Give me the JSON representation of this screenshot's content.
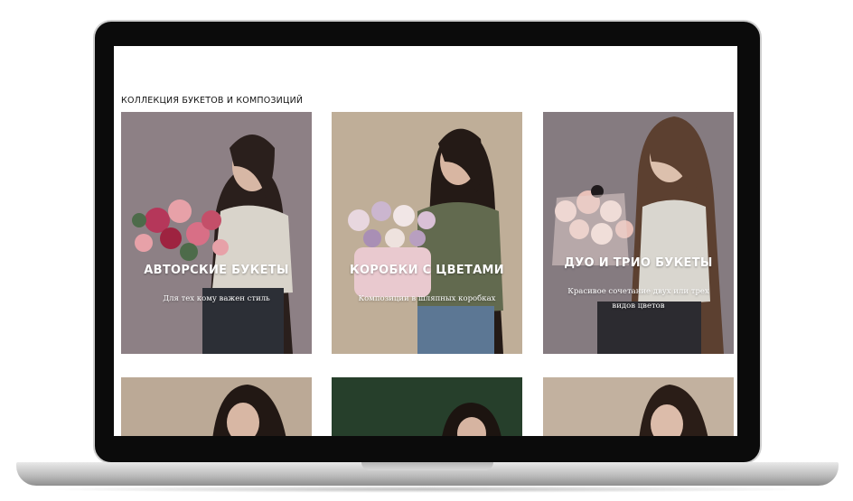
{
  "section": {
    "title": "КОЛЛЕКЦИЯ БУКЕТОВ И КОМПОЗИЦИЙ"
  },
  "cards": [
    {
      "title": "АВТОРСКИЕ БУКЕТЫ",
      "subtitle": "Для тех кому важен стиль"
    },
    {
      "title": "КОРОБКИ С ЦВЕТАМИ",
      "subtitle": "Композиции в шляпных коробках"
    },
    {
      "title": "ДУО И ТРИО БУКЕТЫ",
      "subtitle": "Красивое сочетание двух или трех видов цветов"
    }
  ],
  "colors": {
    "card1_bg": "#8f8287",
    "card2_bg": "#bfae98",
    "card3_bg": "#857b80",
    "card5_bg": "#263f2b",
    "text_on_image": "#ffffff"
  }
}
